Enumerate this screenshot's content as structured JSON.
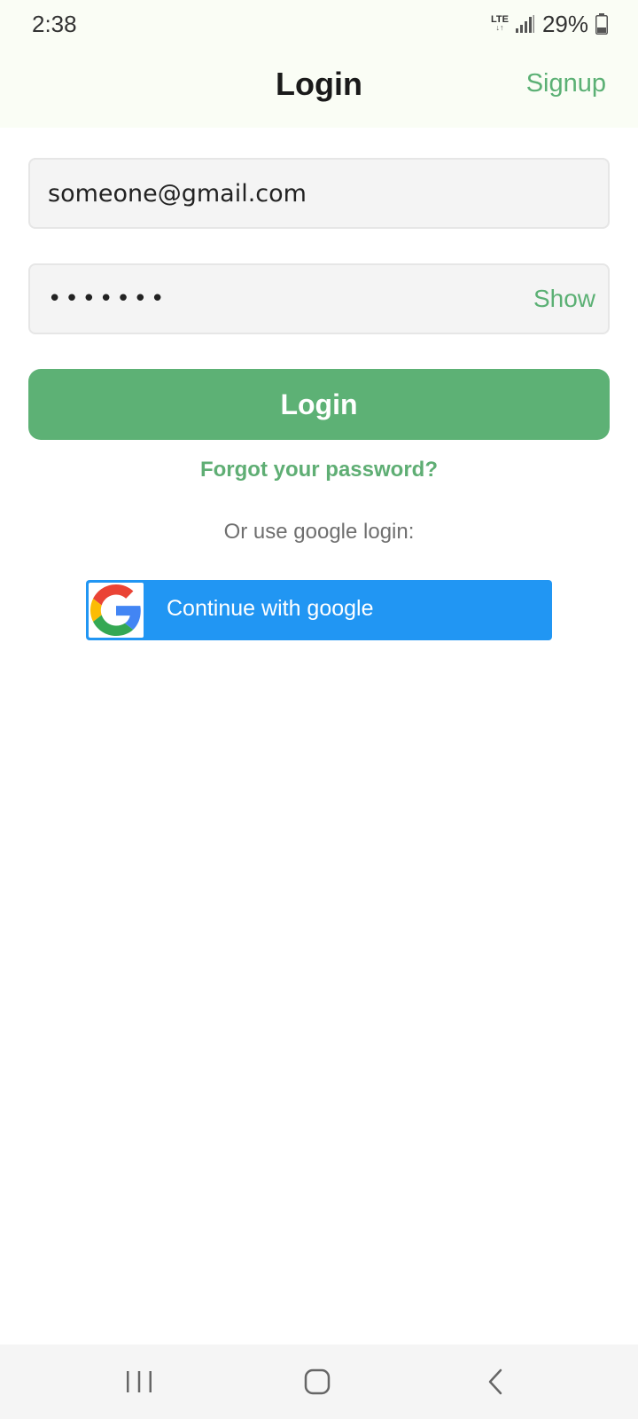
{
  "status_bar": {
    "time": "2:38",
    "network": "LTE",
    "battery": "29%"
  },
  "header": {
    "title": "Login",
    "signup_label": "Signup"
  },
  "form": {
    "email_value": "someone@gmail.com",
    "password_value": "•••••••",
    "show_label": "Show",
    "login_label": "Login",
    "forgot_label": "Forgot your password?",
    "or_text": "Or use google login:",
    "google_label": "Continue with google"
  },
  "colors": {
    "accent": "#5db175",
    "google_blue": "#2196f3",
    "header_bg": "#fafdf5",
    "field_bg": "#f4f4f4"
  },
  "icons": {
    "google": "google-g-logo-icon",
    "signal": "signal-icon",
    "battery": "battery-icon",
    "nav_recent": "recent-apps-icon",
    "nav_home": "home-icon",
    "nav_back": "back-icon"
  }
}
